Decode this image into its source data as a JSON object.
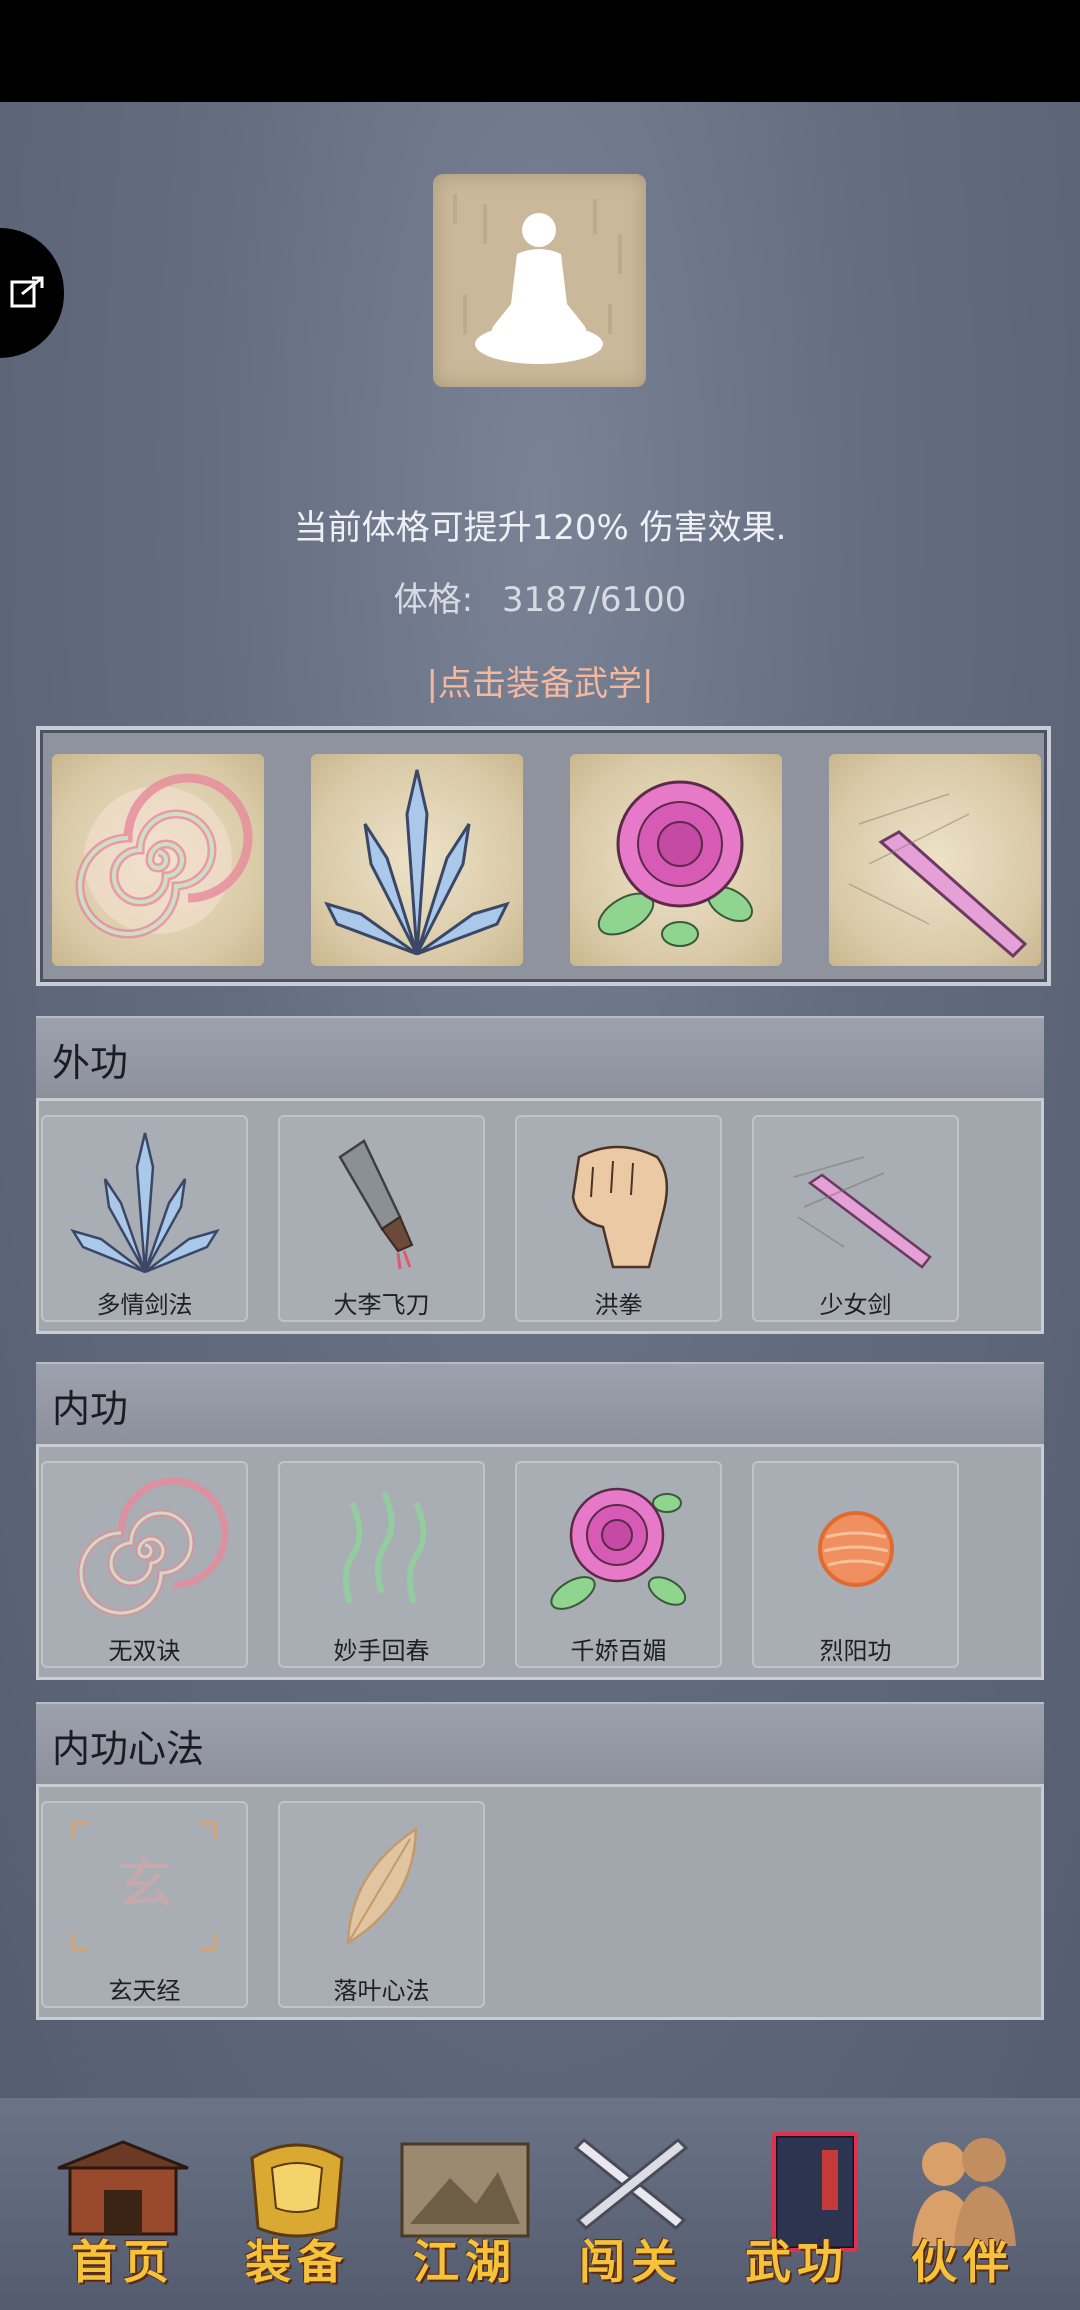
{
  "physique": {
    "effect_text": "当前体格可提升120% 伤害效果.",
    "stat_label": "体格:",
    "stat_value": "3187/6100",
    "equip_hint": "|点击装备武学|"
  },
  "sections": [
    {
      "title": "外功",
      "skills": [
        {
          "name": "多情剑法",
          "icon": "blue-crystal-swords-icon"
        },
        {
          "name": "大李飞刀",
          "icon": "flying-cleaver-icon"
        },
        {
          "name": "洪拳",
          "icon": "fist-icon"
        },
        {
          "name": "少女剑",
          "icon": "pink-sword-icon"
        }
      ]
    },
    {
      "title": "内功",
      "skills": [
        {
          "name": "无双诀",
          "icon": "swirl-icon"
        },
        {
          "name": "妙手回春",
          "icon": "green-waves-icon"
        },
        {
          "name": "千娇百媚",
          "icon": "rose-icon"
        },
        {
          "name": "烈阳功",
          "icon": "orange-sun-icon"
        }
      ]
    },
    {
      "title": "内功心法",
      "skills": [
        {
          "name": "玄天经",
          "icon": "xuan-glyph-icon"
        },
        {
          "name": "落叶心法",
          "icon": "leaf-icon"
        }
      ]
    }
  ],
  "equipped": [
    "swirl-icon",
    "blue-crystal-swords-icon",
    "rose-icon",
    "pink-sword-icon"
  ],
  "nav": [
    {
      "label": "首页",
      "icon": "temple-icon"
    },
    {
      "label": "装备",
      "icon": "golden-armor-icon"
    },
    {
      "label": "江湖",
      "icon": "scroll-map-icon"
    },
    {
      "label": "闯关",
      "icon": "crossed-swords-icon"
    },
    {
      "label": "武功",
      "icon": "book-icon",
      "active": true
    },
    {
      "label": "伙伴",
      "icon": "companions-icon"
    }
  ],
  "colors": {
    "background": "#5c6478",
    "accent_hint": "#f2b9a0",
    "nav_text": "#f5c23a",
    "active_tab": "#e03050"
  }
}
